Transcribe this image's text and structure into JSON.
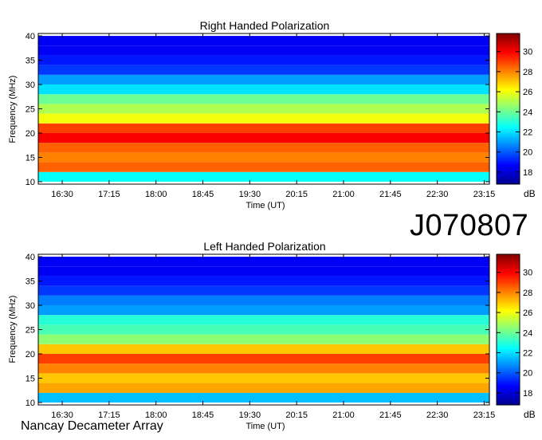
{
  "observation_id": "J070807",
  "credit": "Nancay Decameter Array",
  "chart_data": [
    {
      "type": "heatmap",
      "title": "Right Handed Polarization",
      "xlabel": "Time (UT)",
      "ylabel": "Frequency (MHz)",
      "x_ticks": [
        "16:30",
        "17:15",
        "18:00",
        "18:45",
        "19:30",
        "20:15",
        "21:00",
        "21:45",
        "22:30",
        "23:15"
      ],
      "x_range": [
        "16:07",
        "23:20"
      ],
      "y_ticks": [
        10,
        15,
        20,
        25,
        30,
        35,
        40
      ],
      "ylim": [
        9.5,
        40.5
      ],
      "colorbar": {
        "label": "dB",
        "ticks": [
          18,
          20,
          22,
          24,
          26,
          28,
          30
        ],
        "range": [
          16.8,
          31.8
        ]
      },
      "colormap": [
        "#00008f",
        "#0000ff",
        "#0080ff",
        "#00ffff",
        "#80ff80",
        "#ffff00",
        "#ff8000",
        "#ff0000",
        "#800000"
      ],
      "band_means_db": [
        {
          "freq_mhz": 11,
          "db": 22.5
        },
        {
          "freq_mhz": 13,
          "db": 28.5
        },
        {
          "freq_mhz": 15,
          "db": 28.0
        },
        {
          "freq_mhz": 17,
          "db": 28.5
        },
        {
          "freq_mhz": 19,
          "db": 30.0
        },
        {
          "freq_mhz": 21,
          "db": 29.0
        },
        {
          "freq_mhz": 23,
          "db": 26.0
        },
        {
          "freq_mhz": 25,
          "db": 25.0
        },
        {
          "freq_mhz": 27,
          "db": 24.0
        },
        {
          "freq_mhz": 29,
          "db": 22.0
        },
        {
          "freq_mhz": 31,
          "db": 21.0
        },
        {
          "freq_mhz": 33,
          "db": 19.5
        },
        {
          "freq_mhz": 35,
          "db": 19.0
        },
        {
          "freq_mhz": 37,
          "db": 18.5
        },
        {
          "freq_mhz": 39,
          "db": 18.5
        }
      ]
    },
    {
      "type": "heatmap",
      "title": "Left Handed Polarization",
      "xlabel": "Time (UT)",
      "ylabel": "Frequency (MHz)",
      "x_ticks": [
        "16:30",
        "17:15",
        "18:00",
        "18:45",
        "19:30",
        "20:15",
        "21:00",
        "21:45",
        "22:30",
        "23:15"
      ],
      "x_range": [
        "16:07",
        "23:20"
      ],
      "y_ticks": [
        10,
        15,
        20,
        25,
        30,
        35,
        40
      ],
      "ylim": [
        9.5,
        40.5
      ],
      "colorbar": {
        "label": "dB",
        "ticks": [
          18,
          20,
          22,
          24,
          26,
          28,
          30
        ],
        "range": [
          16.8,
          31.8
        ]
      },
      "colormap": [
        "#00008f",
        "#0000ff",
        "#0080ff",
        "#00ffff",
        "#80ff80",
        "#ffff00",
        "#ff8000",
        "#ff0000",
        "#800000"
      ],
      "band_means_db": [
        {
          "freq_mhz": 11,
          "db": 21.5
        },
        {
          "freq_mhz": 13,
          "db": 27.5
        },
        {
          "freq_mhz": 15,
          "db": 27.0
        },
        {
          "freq_mhz": 17,
          "db": 28.0
        },
        {
          "freq_mhz": 19,
          "db": 29.0
        },
        {
          "freq_mhz": 21,
          "db": 27.0
        },
        {
          "freq_mhz": 23,
          "db": 24.5
        },
        {
          "freq_mhz": 25,
          "db": 23.5
        },
        {
          "freq_mhz": 27,
          "db": 23.0
        },
        {
          "freq_mhz": 29,
          "db": 21.0
        },
        {
          "freq_mhz": 31,
          "db": 20.5
        },
        {
          "freq_mhz": 33,
          "db": 19.5
        },
        {
          "freq_mhz": 35,
          "db": 19.0
        },
        {
          "freq_mhz": 37,
          "db": 18.5
        },
        {
          "freq_mhz": 39,
          "db": 18.5
        }
      ]
    }
  ]
}
